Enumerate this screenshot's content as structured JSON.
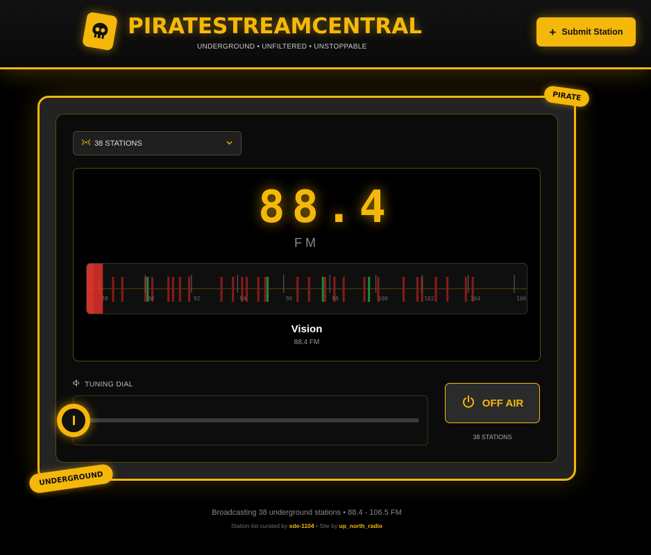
{
  "header": {
    "title": "PIRATESTREAMCENTRAL",
    "tagline": "UNDERGROUND • UNFILTERED • UNSTOPPABLE",
    "submit_label": "Submit Station"
  },
  "stickers": {
    "top_right": "PIRATE",
    "bottom_left": "UNDERGROUND"
  },
  "station_select": {
    "value": "38 STATIONS"
  },
  "display": {
    "frequency": "88.4",
    "unit": "FM",
    "station_name": "Vision",
    "station_freq": "88.4 FM"
  },
  "band": {
    "tick_labels": [
      "88",
      "90",
      "92",
      "94",
      "96",
      "98",
      "100",
      "102",
      "104",
      "106"
    ],
    "range": [
      88,
      107
    ],
    "stations_red": [
      88.6,
      89.0,
      90.0,
      90.3,
      91.0,
      91.2,
      91.5,
      91.9,
      93.3,
      93.8,
      94.2,
      94.4,
      94.9,
      95.2,
      96.6,
      97.1,
      97.8,
      98.2,
      98.6,
      99.5,
      100.1,
      101.2,
      101.8,
      102.0,
      102.6,
      103.1,
      103.9,
      104.2,
      106.6
    ],
    "stations_green": [
      90.1,
      95.3,
      97.7,
      99.7
    ],
    "colors": {
      "red": "#8a1a1a",
      "green": "#1c8a3a",
      "accent": "#f5b80a"
    }
  },
  "tuning": {
    "label": "TUNING DIAL"
  },
  "power": {
    "label": "OFF AIR",
    "count": "38 STATIONS"
  },
  "footer": {
    "summary": "Broadcasting 38 underground stations • 88.4 - 106.5 FM",
    "credit_prefix": "Station list curated by",
    "curator": "sde-1104",
    "credit_mid": "• Site by",
    "site_by": "up_north_radio"
  }
}
